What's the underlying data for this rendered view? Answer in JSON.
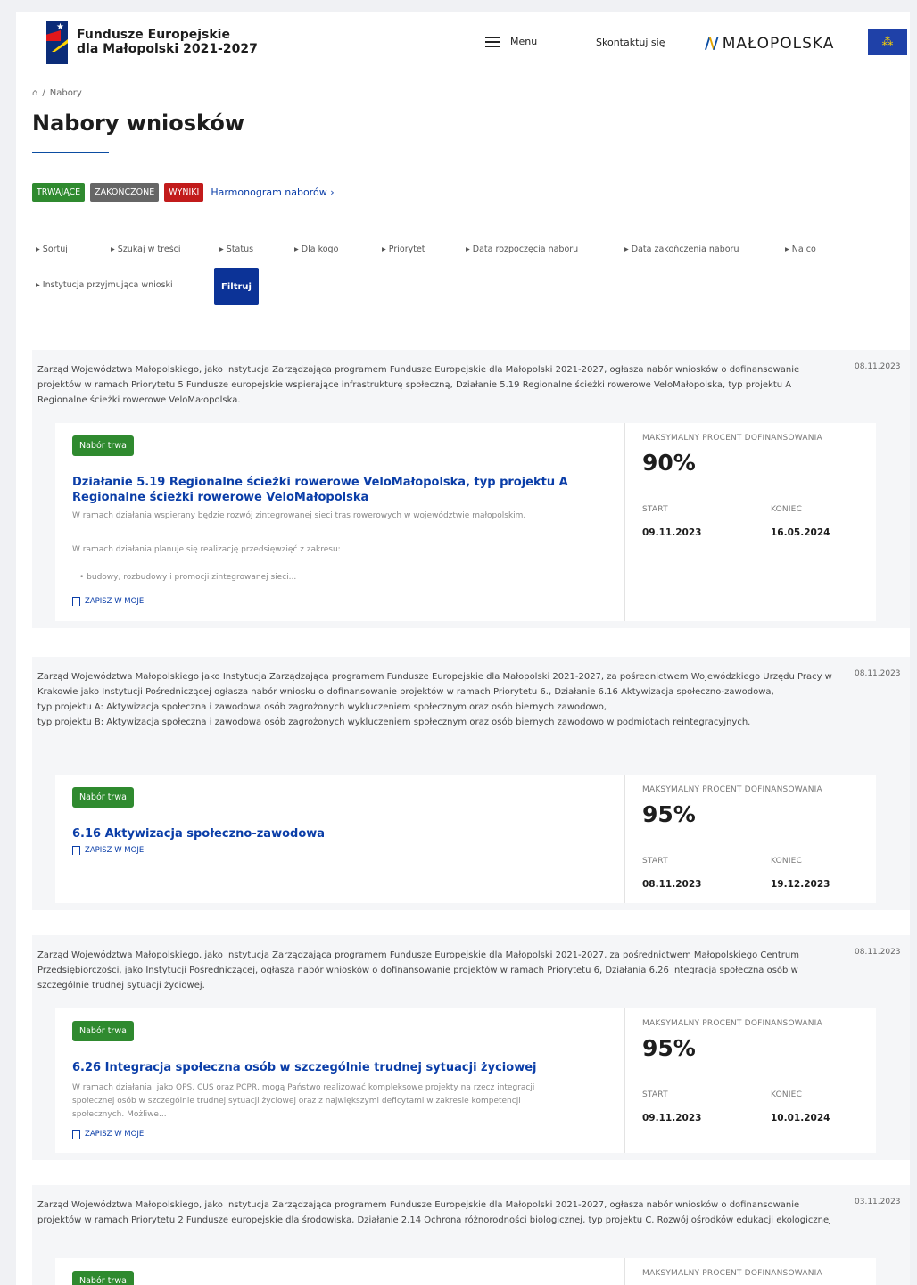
{
  "header": {
    "brand_line1": "Fundusze Europejskie",
    "brand_line2": "dla Małopolski 2021-2027",
    "menu_label": "Menu",
    "contact_label": "Skontaktuj się",
    "region_logo_text": "MAŁOPOLSKA"
  },
  "breadcrumb": {
    "home_icon": "home-icon",
    "separator": "/",
    "current": "Nabory"
  },
  "page_title": "Nabory wniosków",
  "status_tabs": {
    "ongoing": "TRWAJĄCE",
    "finished": "ZAKOŃCZONE",
    "results": "WYNIKI",
    "schedule_link": "Harmonogram naborów ›"
  },
  "filters": {
    "sort": "▸ Sortuj",
    "search": "▸ Szukaj w treści",
    "status": "▸ Status",
    "for_whom": "▸ Dla kogo",
    "priority": "▸ Priorytet",
    "start_date": "▸ Data rozpoczęcia naboru",
    "end_date": "▸ Data zakończenia naboru",
    "for_what": "▸ Na co",
    "institution": "▸ Instytucja przyjmująca wnioski",
    "filter_button": "Filtruj"
  },
  "labels": {
    "max_percent": "MAKSYMALNY PROCENT DOFINANSOWANIA",
    "start": "START",
    "end": "KONIEC",
    "save": "ZAPISZ W MOJE",
    "status_badge": "Nabór trwa"
  },
  "cards": [
    {
      "date": "08.11.2023",
      "description": "Zarząd Województwa Małopolskiego, jako Instytucja Zarządzająca programem Fundusze Europejskie dla Małopolski 2021-2027, ogłasza nabór wniosków o dofinansowanie projektów w ramach Priorytetu 5 Fundusze europejskie wspierające infrastrukturę społeczną, Działanie 5.19 Regionalne ścieżki rowerowe VeloMałopolska, typ projektu A Regionalne ścieżki rowerowe VeloMałopolska.",
      "title": "Działanie 5.19 Regionalne ścieżki rowerowe VeloMałopolska, typ projektu A Regionalne ścieżki rowerowe VeloMałopolska",
      "short1": "W ramach działania wspierany będzie rozwój zintegrowanej sieci tras rowerowych w województwie małopolskim.",
      "short2": "W ramach działania planuje się realizację przedsięwzięć z zakresu:",
      "short3": "• budowy, rozbudowy i promocji zintegrowanej sieci...",
      "percent": "90%",
      "start": "09.11.2023",
      "end": "16.05.2024"
    },
    {
      "date": "08.11.2023",
      "description1": "Zarząd Województwa Małopolskiego jako Instytucja Zarządzająca programem Fundusze Europejskie dla Małopolski 2021-2027, za pośrednictwem Wojewódzkiego Urzędu Pracy w Krakowie jako Instytucji Pośredniczącej ogłasza nabór wniosku o dofinansowanie projektów w ramach Priorytetu 6., Działanie 6.16 Aktywizacja społeczno-zawodowa,",
      "description2": "typ projektu A: Aktywizacja społeczna i zawodowa osób zagrożonych wykluczeniem społecznym oraz osób biernych zawodowo,",
      "description3": "typ projektu B: Aktywizacja społeczna i zawodowa osób zagrożonych wykluczeniem społecznym oraz osób biernych zawodowo w podmiotach reintegracyjnych.",
      "title": "6.16 Aktywizacja społeczno-zawodowa",
      "percent": "95%",
      "start": "08.11.2023",
      "end": "19.12.2023"
    },
    {
      "date": "08.11.2023",
      "description": "Zarząd Województwa Małopolskiego, jako Instytucja Zarządzająca programem Fundusze Europejskie dla Małopolski 2021-2027, za pośrednictwem Małopolskiego Centrum Przedsiębiorczości, jako Instytucji Pośredniczącej, ogłasza nabór wniosków o dofinansowanie projektów w ramach Priorytetu 6, Działania 6.26 Integracja społeczna osób w szczególnie trudnej sytuacji życiowej.",
      "title": "6.26 Integracja społeczna osób w szczególnie trudnej sytuacji życiowej",
      "short1": "W ramach działania, jako OPS, CUS oraz PCPR, mogą Państwo realizować kompleksowe projekty na rzecz integracji społecznej osób w szczególnie trudnej sytuacji życiowej oraz z największymi deficytami w zakresie kompetencji społecznych. Możliwe...",
      "percent": "95%",
      "start": "09.11.2023",
      "end": "10.01.2024"
    },
    {
      "date": "03.11.2023",
      "description": "Zarząd Województwa Małopolskiego, jako Instytucja Zarządzająca programem Fundusze Europejskie dla Małopolski 2021-2027, ogłasza nabór wniosków o dofinansowanie projektów w ramach Priorytetu 2 Fundusze europejskie dla środowiska, Działanie 2.14 Ochrona różnorodności biologicznej, typ projektu C. Rozwój ośrodków edukacji ekologicznej"
    }
  ]
}
